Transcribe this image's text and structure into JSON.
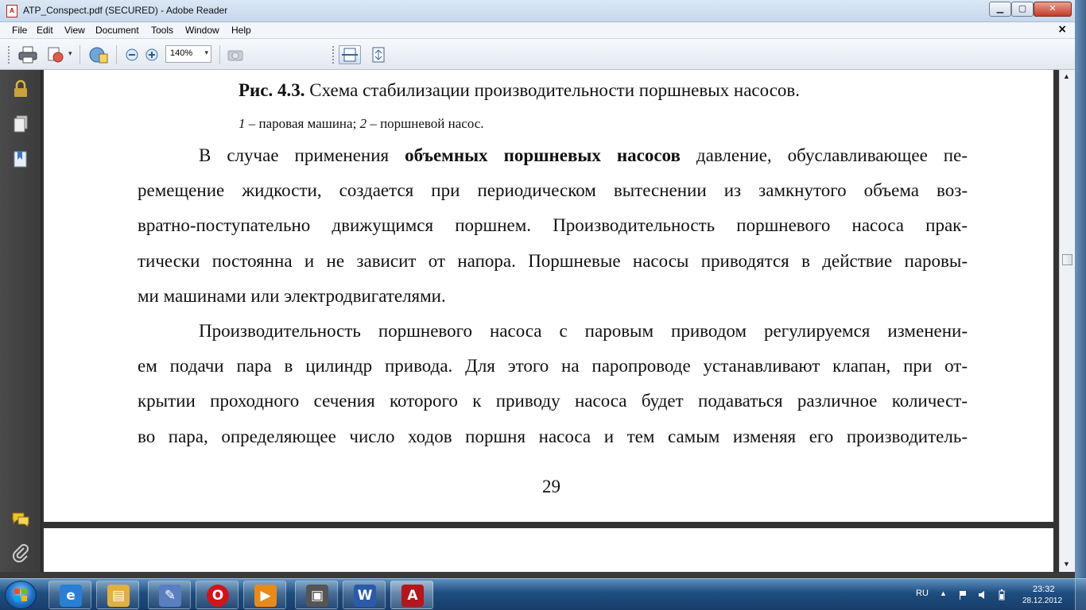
{
  "window": {
    "title": "ATP_Conspect.pdf (SECURED) - Adobe Reader",
    "minimize": "▁",
    "maximize": "▢",
    "close": "✕"
  },
  "menu": {
    "items": [
      "File",
      "Edit",
      "View",
      "Document",
      "Tools",
      "Window",
      "Help"
    ],
    "close": "×"
  },
  "toolbar": {
    "zoom": "140%",
    "zoom_arrow": "▾"
  },
  "document": {
    "caption_bold": "Рис. 4.3.",
    "caption_text": " Схема стабилизации производительности поршневых насосов.",
    "legend_1_num": "1",
    "legend_1_text": " – паровая машина; ",
    "legend_2_num": "2",
    "legend_2_text": " – поршневой насос.",
    "p1_l1_before": "В случае применения ",
    "p1_l1_bold": "объемных поршневых насосов",
    "p1_l1_after": " давление, обуславливающее пе-",
    "p1_l2": "ремещение жидкости, создается при периодическом вытеснении из замкнутого объема воз-",
    "p1_l3": "вратно-поступательно движущимся поршнем. Производительность поршневого насоса прак-",
    "p1_l4": "тически постоянна и не зависит от напора. Поршневые насосы приводятся в действие паровы-",
    "p1_l5": "ми машинами или электродвигателями.",
    "p2_l1": "Производительность поршневого насоса с паровым приводом регулируемся изменени-",
    "p2_l2": "ем подачи пара в цилиндр привода. Для этого на паропроводе устанавливают клапан, при от-",
    "p2_l3": "крытии проходного сечения которого к приводу насоса будет подаваться различное количест-",
    "p2_l4": "во пара, определяющее число ходов поршня насоса и тем самым изменяя его производитель-",
    "page_number": "29"
  },
  "scrollbar": {
    "up": "▲",
    "down": "▼"
  },
  "taskbar": {
    "language": "RU",
    "time": "23:32",
    "date": "28.12.2012",
    "apps": [
      {
        "icon": "internet-explorer-icon",
        "glyph": "e",
        "color": "#2a7fd4"
      },
      {
        "icon": "file-explorer-icon",
        "glyph": "▤",
        "color": "#e0b040"
      },
      {
        "icon": "tools-icon",
        "glyph": "✎",
        "color": "#5a7fc0"
      },
      {
        "icon": "opera-icon",
        "glyph": "O",
        "color": "#d0141b"
      },
      {
        "icon": "media-player-icon",
        "glyph": "▶",
        "color": "#e88a1a"
      },
      {
        "icon": "scanner-icon",
        "glyph": "▣",
        "color": "#555555"
      },
      {
        "icon": "word-icon",
        "glyph": "W",
        "color": "#2b5aa8"
      },
      {
        "icon": "adobe-reader-icon",
        "glyph": "A",
        "color": "#b3161c"
      }
    ]
  }
}
